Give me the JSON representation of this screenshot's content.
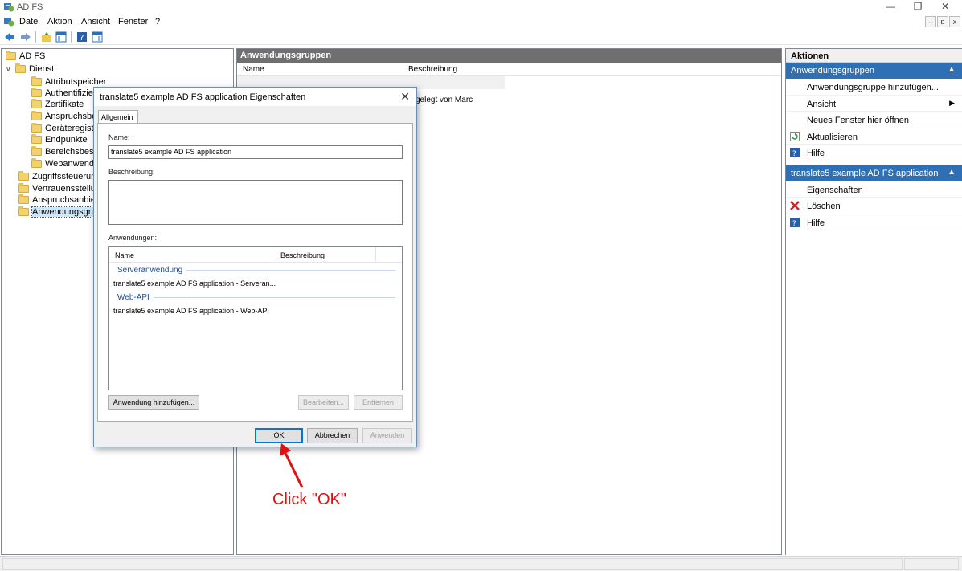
{
  "window": {
    "title": "AD FS",
    "minimize": "—",
    "restore": "❐",
    "close": "✕"
  },
  "menu": {
    "items": [
      "Datei",
      "Aktion",
      "Ansicht",
      "Fenster",
      "?"
    ],
    "mdi_minimize": "–",
    "mdi_restore": "ɒ",
    "mdi_close": "x"
  },
  "tree": {
    "root": "AD FS",
    "dienst": "Dienst",
    "dienst_children": [
      "Attributspeicher",
      "Authentifizier",
      "Zertifikate",
      "Anspruchsbesc",
      "Geräteregistrie",
      "Endpunkte",
      "Bereichsbesch",
      "Webanwendu"
    ],
    "root_children": [
      "Zugriffssteuerung",
      "Vertrauensstellun",
      "Anspruchsanbiete",
      "Anwendungsgrup"
    ]
  },
  "center": {
    "header": "Anwendungsgruppen",
    "col_name": "Name",
    "col_desc": "Beschreibung",
    "row_desc": "gelegt von Marc"
  },
  "actions": {
    "header": "Aktionen",
    "section1": "Anwendungsgruppen",
    "section1_items": [
      "Anwendungsgruppe hinzufügen...",
      "Ansicht",
      "Neues Fenster hier öffnen",
      "Aktualisieren",
      "Hilfe"
    ],
    "section2": "translate5 example AD FS application",
    "section2_items": [
      "Eigenschaften",
      "Löschen",
      "Hilfe"
    ]
  },
  "dialog": {
    "title": "translate5 example AD FS application Eigenschaften",
    "tab": "Allgemein",
    "name_label": "Name:",
    "name_value": "translate5 example AD FS application",
    "desc_label": "Beschreibung:",
    "desc_value": "",
    "apps_label": "Anwendungen:",
    "col_name": "Name",
    "col_desc": "Beschreibung",
    "group1": "Serveranwendung",
    "group1_row": "translate5 example AD FS application - Serveran...",
    "group2": "Web-API",
    "group2_row": "translate5 example AD FS application - Web-API",
    "add_button": "Anwendung hinzufügen...",
    "edit_button": "Bearbeiten...",
    "remove_button": "Entfernen",
    "ok_button": "OK",
    "cancel_button": "Abbrechen",
    "apply_button": "Anwenden"
  },
  "annotation": {
    "text": "Click \"OK\"",
    "color": "#e01010"
  }
}
